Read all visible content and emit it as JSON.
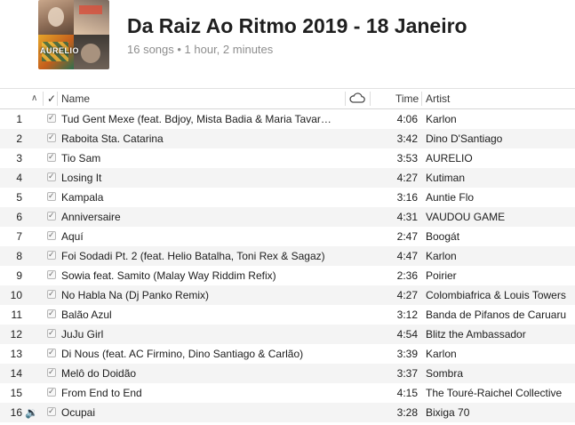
{
  "playlist": {
    "title": "Da Raiz Ao Ritmo 2019 - 18 Janeiro",
    "subtitle": "16 songs • 1 hour, 2 minutes",
    "artwork_text": "AURELIO"
  },
  "columns": {
    "sort_indicator": "∧",
    "checkbox": "✓",
    "name": "Name",
    "cloud": "cloud-icon",
    "time": "Time",
    "artist": "Artist"
  },
  "colors": {
    "row_alt": "#f4f4f4",
    "now_playing": "#2f7de1",
    "subtitle": "#8e8e8e"
  },
  "tracks": [
    {
      "num": "1",
      "name": "Tud Gent Mexe (feat. Bdjoy, Mista Badia & Maria Tavar…",
      "time": "4:06",
      "artist": "Karlon",
      "playing": ""
    },
    {
      "num": "2",
      "name": "Raboita Sta. Catarina",
      "time": "3:42",
      "artist": "Dino D'Santiago",
      "playing": ""
    },
    {
      "num": "3",
      "name": "Tio Sam",
      "time": "3:53",
      "artist": "AURELIO",
      "playing": ""
    },
    {
      "num": "4",
      "name": "Losing It",
      "time": "4:27",
      "artist": "Kutiman",
      "playing": ""
    },
    {
      "num": "5",
      "name": "Kampala",
      "time": "3:16",
      "artist": "Auntie Flo",
      "playing": ""
    },
    {
      "num": "6",
      "name": "Anniversaire",
      "time": "4:31",
      "artist": "VAUDOU GAME",
      "playing": ""
    },
    {
      "num": "7",
      "name": "Aquí",
      "time": "2:47",
      "artist": "Boogát",
      "playing": ""
    },
    {
      "num": "8",
      "name": "Foi Sodadi Pt. 2 (feat. Helio Batalha, Toni Rex & Sagaz)",
      "time": "4:47",
      "artist": "Karlon",
      "playing": ""
    },
    {
      "num": "9",
      "name": "Sowia feat. Samito (Malay Way Riddim Refix)",
      "time": "2:36",
      "artist": "Poirier",
      "playing": ""
    },
    {
      "num": "10",
      "name": "No Habla Na (Dj Panko Remix)",
      "time": "4:27",
      "artist": "Colombiafrica & Louis Towers",
      "playing": ""
    },
    {
      "num": "11",
      "name": "Balão Azul",
      "time": "3:12",
      "artist": "Banda de Pifanos de Caruaru",
      "playing": ""
    },
    {
      "num": "12",
      "name": "JuJu Girl",
      "time": "4:54",
      "artist": "Blitz the Ambassador",
      "playing": ""
    },
    {
      "num": "13",
      "name": "Di Nous (feat. AC Firmino, Dino Santiago & Carlão)",
      "time": "3:39",
      "artist": "Karlon",
      "playing": ""
    },
    {
      "num": "14",
      "name": "Melô do Doidão",
      "time": "3:37",
      "artist": "Sombra",
      "playing": ""
    },
    {
      "num": "15",
      "name": "From End to End",
      "time": "4:15",
      "artist": "The Touré-Raichel Collective",
      "playing": ""
    },
    {
      "num": "16",
      "name": "Ocupai",
      "time": "3:28",
      "artist": "Bixiga 70",
      "playing": "🔉"
    }
  ]
}
